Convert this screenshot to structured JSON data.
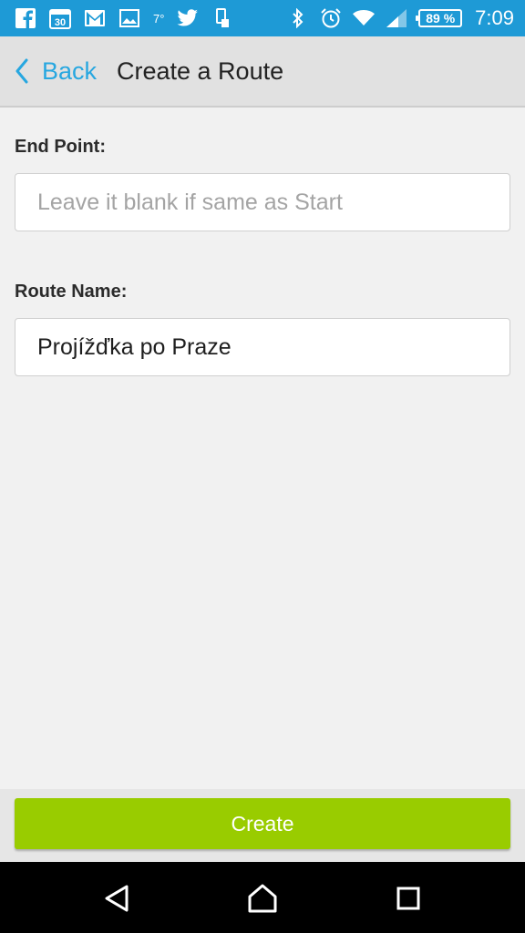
{
  "status_bar": {
    "temperature": "7°",
    "battery": "89 %",
    "time": "7:09",
    "icons": [
      "facebook-icon",
      "calendar-icon",
      "gmail-icon",
      "gallery-icon",
      "twitter-icon",
      "phone-icon",
      "bluetooth-icon",
      "alarm-icon",
      "wifi-icon",
      "signal-icon",
      "battery-icon"
    ]
  },
  "header": {
    "back_label": "Back",
    "title": "Create a Route"
  },
  "form": {
    "end_point": {
      "label": "End Point:",
      "value": "",
      "placeholder": "Leave it blank if same as Start"
    },
    "route_name": {
      "label": "Route Name:",
      "value": "Projížďka po Praze",
      "placeholder": ""
    }
  },
  "actions": {
    "create_label": "Create"
  },
  "colors": {
    "status_bar": "#1e9ad6",
    "accent_link": "#27a7e0",
    "create_button": "#99cc00",
    "background": "#f1f1f1"
  },
  "nav": {
    "icons": [
      "back-triangle-icon",
      "home-icon",
      "recents-icon"
    ]
  }
}
